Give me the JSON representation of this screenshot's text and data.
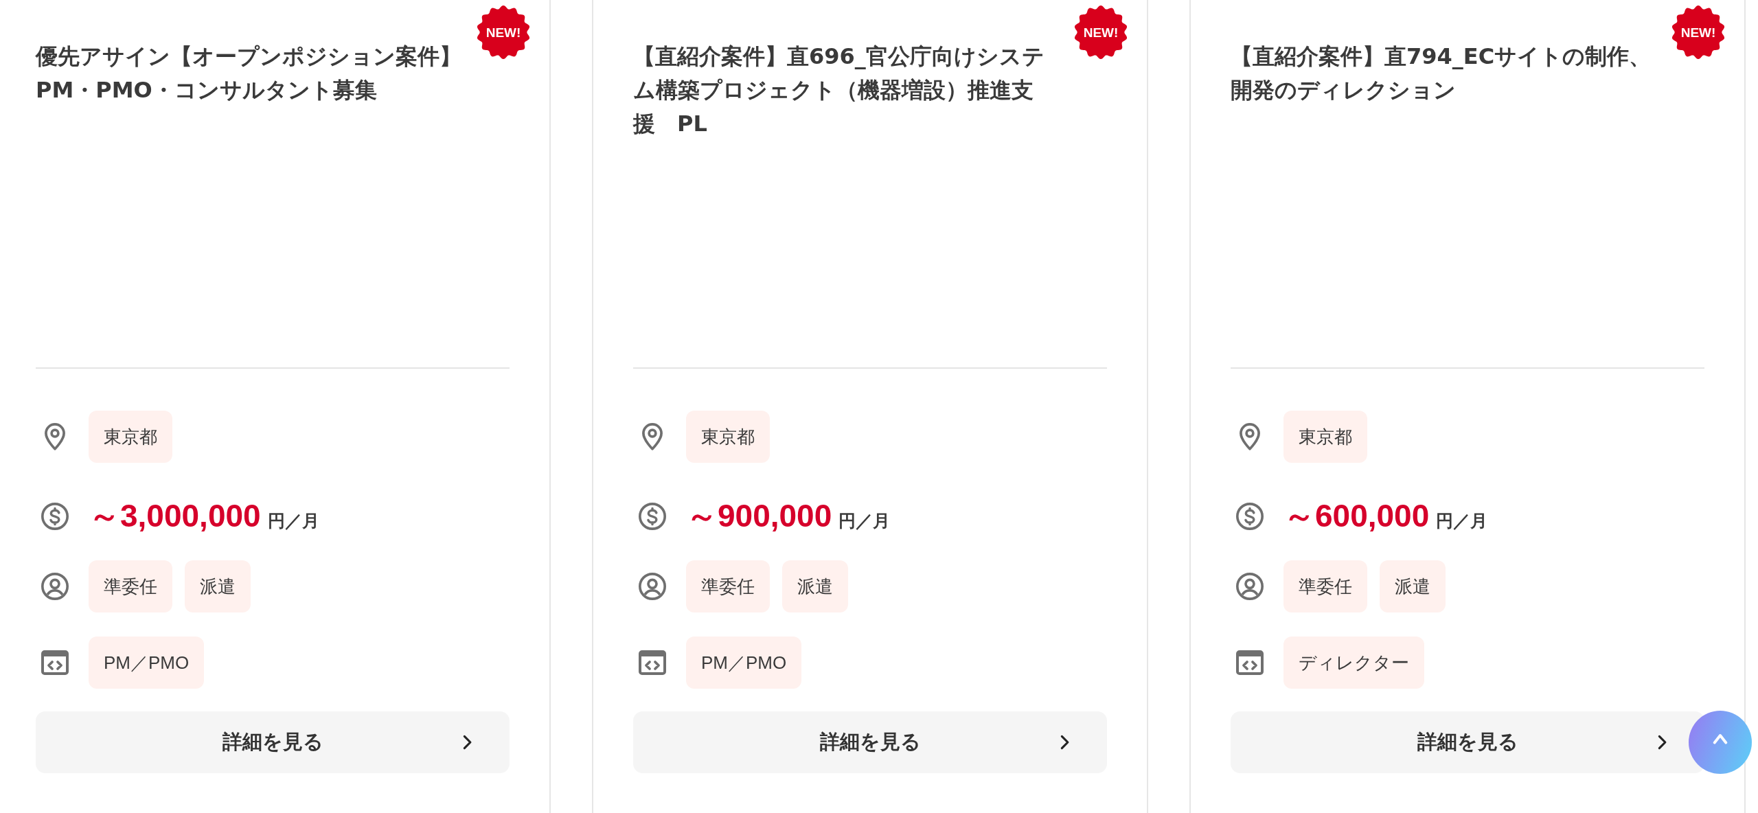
{
  "cards": [
    {
      "badge": "NEW!",
      "title": "優先アサイン【オープンポジション案件】PM・PMO・コンサルタント募集",
      "location": [
        "東京都"
      ],
      "salary": {
        "amount": "～3,000,000",
        "unit": "円／月"
      },
      "contract_types": [
        "準委任",
        "派遣"
      ],
      "categories": [
        "PM／PMO"
      ],
      "button": "詳細を見る"
    },
    {
      "badge": "NEW!",
      "title": "【直紹介案件】直696_官公庁向けシステム構築プロジェクト（機器増設）推進支援　PL",
      "location": [
        "東京都"
      ],
      "salary": {
        "amount": "～900,000",
        "unit": "円／月"
      },
      "contract_types": [
        "準委任",
        "派遣"
      ],
      "categories": [
        "PM／PMO"
      ],
      "button": "詳細を見る"
    },
    {
      "badge": "NEW!",
      "title": "【直紹介案件】直794_ECサイトの制作、開発のディレクション",
      "location": [
        "東京都"
      ],
      "salary": {
        "amount": "～600,000",
        "unit": "円／月"
      },
      "contract_types": [
        "準委任",
        "派遣"
      ],
      "categories": [
        "ディレクター"
      ],
      "button": "詳細を見る"
    }
  ]
}
